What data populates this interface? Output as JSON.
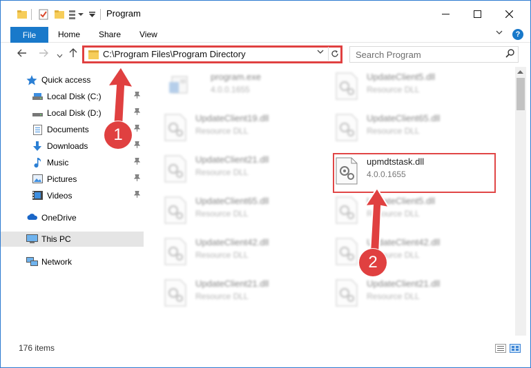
{
  "window": {
    "title": "Program",
    "buttons": {
      "minimize": "—",
      "maximize": "☐",
      "close": "✕"
    }
  },
  "ribbon": {
    "file": "File",
    "tabs": [
      "Home",
      "Share",
      "View"
    ]
  },
  "address": {
    "path": "C:\\Program Files\\Program Directory"
  },
  "search": {
    "placeholder": "Search Program"
  },
  "sidebar": {
    "items": [
      {
        "label": "Quick access",
        "icon": "star-icon"
      },
      {
        "label": "Local Disk (C:)",
        "icon": "drive-icon",
        "pinned": true
      },
      {
        "label": "Local Disk (D:)",
        "icon": "drive-icon",
        "pinned": true
      },
      {
        "label": "Documents",
        "icon": "documents-icon",
        "pinned": true
      },
      {
        "label": "Downloads",
        "icon": "download-icon",
        "pinned": true
      },
      {
        "label": "Music",
        "icon": "music-icon",
        "pinned": true
      },
      {
        "label": "Pictures",
        "icon": "pictures-icon",
        "pinned": true
      },
      {
        "label": "Videos",
        "icon": "videos-icon",
        "pinned": true
      },
      {
        "label": "OneDrive",
        "icon": "cloud-icon"
      },
      {
        "label": "This PC",
        "icon": "computer-icon",
        "selected": true
      },
      {
        "label": "Network",
        "icon": "network-icon"
      }
    ]
  },
  "files": {
    "left": [
      {
        "name": "program.exe",
        "sub": "4.0.0.1655"
      },
      {
        "name": "UpdateClient19.dll",
        "sub": "Resource DLL"
      },
      {
        "name": "UpdateClient21.dll",
        "sub": "Resource DLL"
      },
      {
        "name": "UpdateClient65.dll",
        "sub": "Resource DLL"
      },
      {
        "name": "UpdateClient42.dll",
        "sub": "Resource DLL"
      },
      {
        "name": "UpdateClient21.dll",
        "sub": "Resource DLL"
      }
    ],
    "right": [
      {
        "name": "UpdateClient5.dll",
        "sub": "Resource DLL"
      },
      {
        "name": "UpdateClient65.dll",
        "sub": "Resource DLL"
      },
      {
        "name": "upmdtstask.dll",
        "sub": "4.0.0.1655"
      },
      {
        "name": "UpdateClient5.dll",
        "sub": "Resource DLL"
      },
      {
        "name": "UpdateClient42.dll",
        "sub": "Resource DLL"
      },
      {
        "name": "UpdateClient21.dll",
        "sub": "Resource DLL"
      }
    ]
  },
  "status": {
    "count": "176 items"
  },
  "annotations": {
    "step1": "1",
    "step2": "2",
    "color": "#e04040"
  }
}
